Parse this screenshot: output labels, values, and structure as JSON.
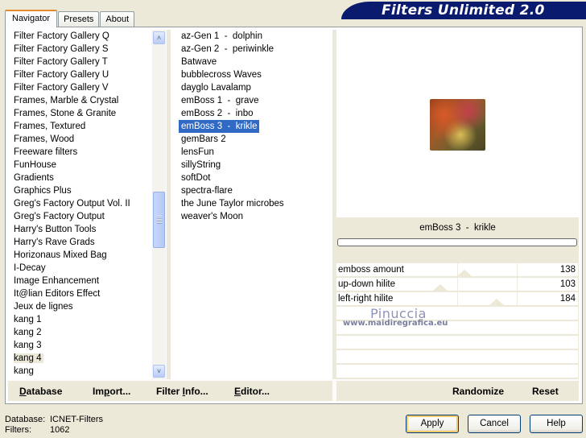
{
  "app": {
    "title": "Filters Unlimited 2.0"
  },
  "tabs": [
    {
      "label": "Navigator",
      "active": true
    },
    {
      "label": "Presets",
      "active": false
    },
    {
      "label": "About",
      "active": false
    }
  ],
  "categories": {
    "selected": "kang 4",
    "items": [
      "Filter Factory Gallery Q",
      "Filter Factory Gallery S",
      "Filter Factory Gallery T",
      "Filter Factory Gallery U",
      "Filter Factory Gallery V",
      "Frames, Marble & Crystal",
      "Frames, Stone & Granite",
      "Frames, Textured",
      "Frames, Wood",
      "Freeware filters",
      "FunHouse",
      "Gradients",
      "Graphics Plus",
      "Greg's Factory Output Vol. II",
      "Greg's Factory Output",
      "Harry's Button Tools",
      "Harry's Rave Grads",
      "Horizonaus Mixed Bag",
      "I-Decay",
      "Image Enhancement",
      "It@lian Editors Effect",
      "Jeux de lignes",
      "kang 1",
      "kang 2",
      "kang 3",
      "kang 4",
      "kang"
    ],
    "scroll": {
      "up_icon": "chevron-up-icon",
      "down_icon": "chevron-down-icon"
    }
  },
  "filters": {
    "selected": "emBoss 3  -  krikle",
    "items": [
      "az-Gen 1  -  dolphin",
      "az-Gen 2  -  periwinkle",
      "Batwave",
      "bubblecross Waves",
      "dayglo Lavalamp",
      "emBoss 1  -  grave",
      "emBoss 2  -  inbo",
      "emBoss 3  -  krikle",
      "gemBars 2",
      "lensFun",
      "sillyString",
      "softDot",
      "spectra-flare",
      "the June Taylor microbes",
      "weaver's Moon"
    ]
  },
  "preview": {
    "filter_name": "emBoss 3  -  krikle",
    "progress": 0
  },
  "parameters": [
    {
      "name": "emboss amount",
      "value": 138,
      "max": 255
    },
    {
      "name": "up-down hilite",
      "value": 103,
      "max": 255
    },
    {
      "name": "left-right hilite",
      "value": 184,
      "max": 255
    }
  ],
  "watermark": {
    "line1": "Pinuccia",
    "line2": "www.maidiregrafica.eu"
  },
  "toolbar": {
    "database": {
      "pre": "",
      "u": "D",
      "post": "atabase"
    },
    "import": {
      "pre": "Im",
      "u": "p",
      "post": "ort..."
    },
    "filter_info": {
      "pre": "Filter ",
      "u": "I",
      "post": "nfo..."
    },
    "editor": {
      "pre": "",
      "u": "E",
      "post": "ditor..."
    },
    "randomize": "Randomize",
    "reset": "Reset"
  },
  "status": {
    "database_label": "Database:",
    "database_value": "ICNET-Filters",
    "filters_label": "Filters:",
    "filters_value": "1062"
  },
  "buttons": {
    "apply": "Apply",
    "cancel": "Cancel",
    "help": "Help"
  }
}
